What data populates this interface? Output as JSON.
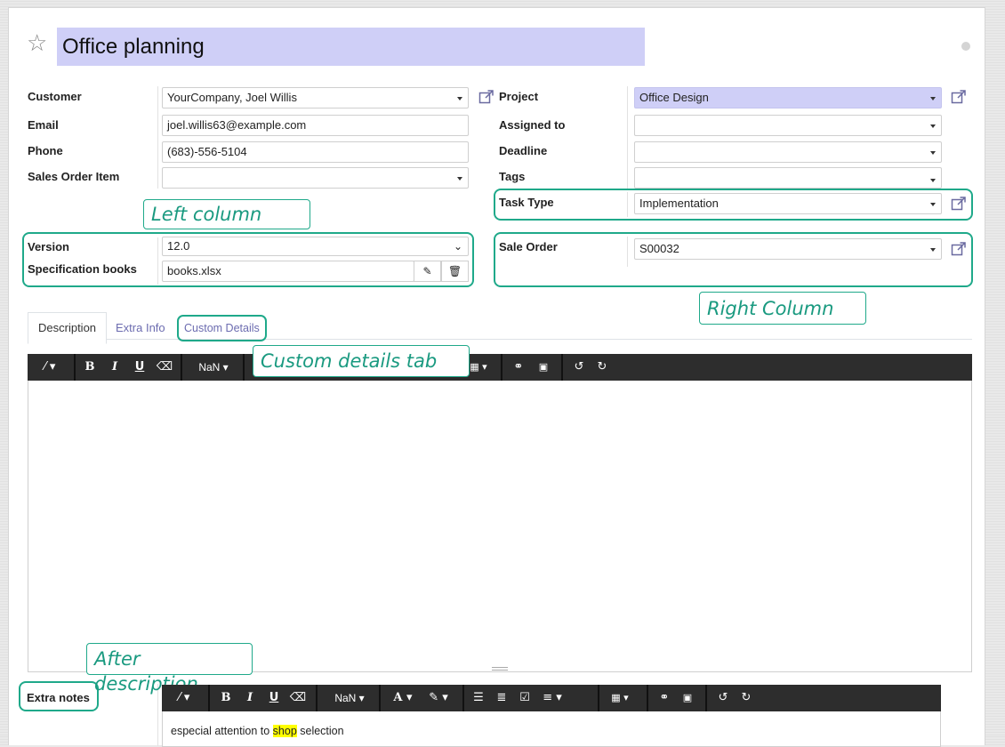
{
  "record": {
    "title": "Office planning"
  },
  "left": {
    "customer": {
      "label": "Customer",
      "value": "YourCompany, Joel Willis"
    },
    "email": {
      "label": "Email",
      "value": "joel.willis63@example.com"
    },
    "phone": {
      "label": "Phone",
      "value": "(683)-556-5104"
    },
    "sales_order_item": {
      "label": "Sales Order Item",
      "value": ""
    },
    "version": {
      "label": "Version",
      "value": "12.0"
    },
    "spec_books": {
      "label": "Specification books",
      "value": "books.xlsx"
    }
  },
  "right": {
    "project": {
      "label": "Project",
      "value": "Office Design"
    },
    "assigned_to": {
      "label": "Assigned to",
      "value": ""
    },
    "deadline": {
      "label": "Deadline",
      "value": ""
    },
    "tags": {
      "label": "Tags",
      "value": ""
    },
    "task_type": {
      "label": "Task Type",
      "value": "Implementation"
    },
    "sale_order": {
      "label": "Sale Order",
      "value": "S00032"
    }
  },
  "tabs": [
    {
      "label": "Description",
      "active": true
    },
    {
      "label": "Extra Info",
      "active": false
    },
    {
      "label": "Custom Details",
      "active": false
    }
  ],
  "toolbar": {
    "bold": "B",
    "italic": "I",
    "underline": "U",
    "font_size": "NaN",
    "font_color": "A"
  },
  "extra_notes": {
    "label": "Extra notes",
    "text_before": "especial attention to ",
    "text_highlight": "shop",
    "text_after": " selection"
  },
  "annotations": {
    "left_column": "Left column",
    "right_column": "Right Column",
    "custom_details_tab": "Custom details tab",
    "after_description": "After description"
  },
  "colors": {
    "accent": "#1fa98a",
    "title_bg": "#cfcff7",
    "toolbar_bg": "#2d2d2d",
    "link": "#6c6cb0",
    "highlight": "#ffff00"
  }
}
